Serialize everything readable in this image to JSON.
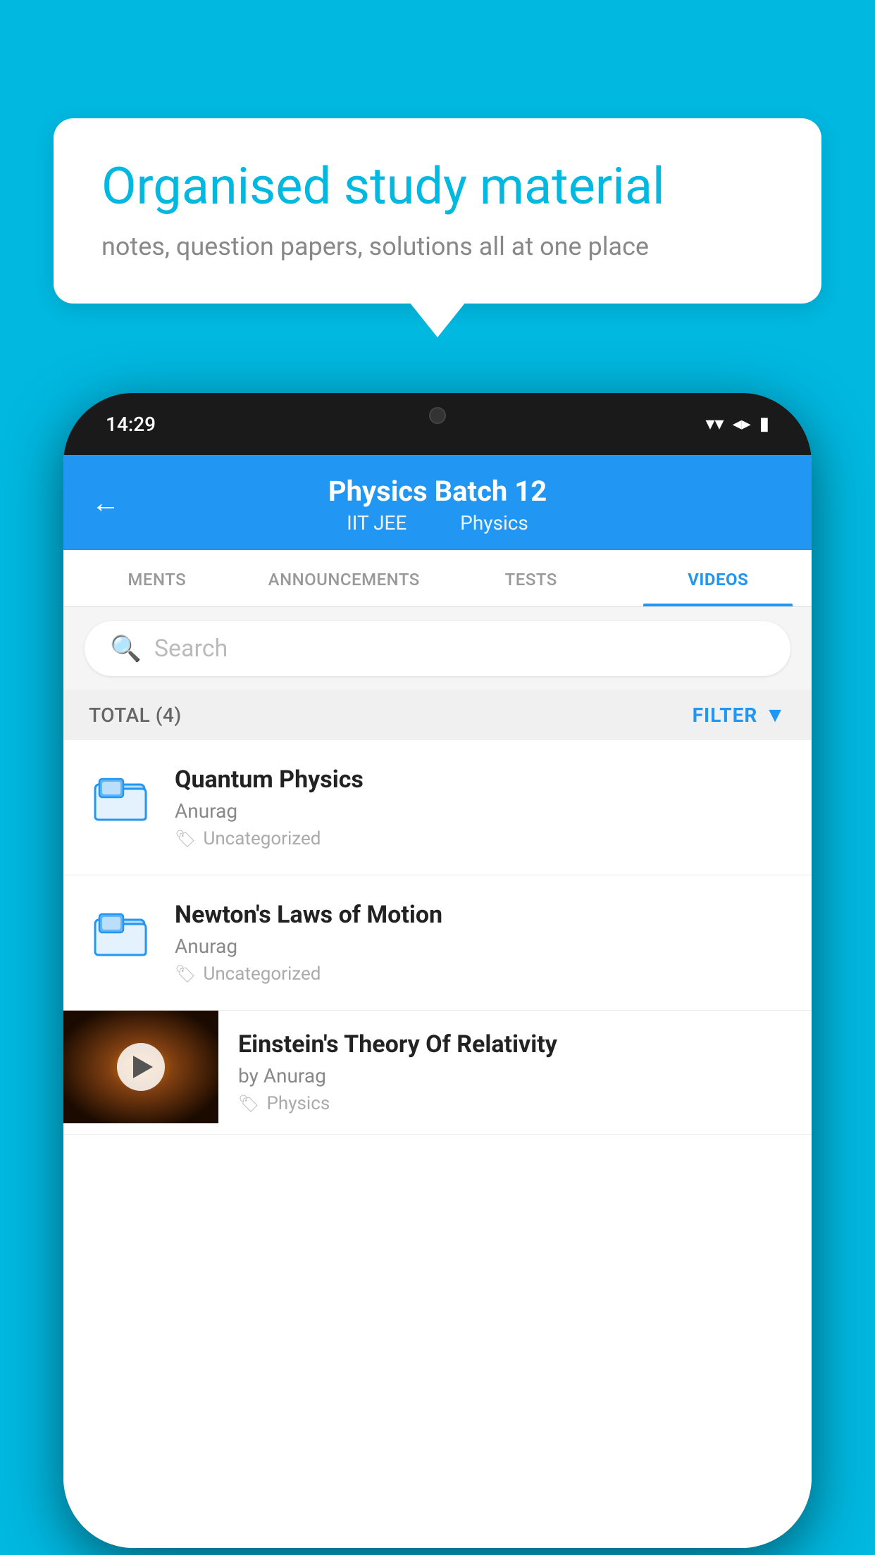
{
  "background_color": "#00b8e0",
  "speech_bubble": {
    "title": "Organised study material",
    "subtitle": "notes, question papers, solutions all at one place"
  },
  "phone": {
    "status_bar": {
      "time": "14:29",
      "wifi": "▼",
      "signal": "▲",
      "battery": "▮"
    },
    "header": {
      "back_label": "←",
      "title": "Physics Batch 12",
      "tag1": "IIT JEE",
      "tag2": "Physics"
    },
    "tabs": [
      {
        "label": "MENTS",
        "active": false
      },
      {
        "label": "ANNOUNCEMENTS",
        "active": false
      },
      {
        "label": "TESTS",
        "active": false
      },
      {
        "label": "VIDEOS",
        "active": true
      }
    ],
    "search": {
      "placeholder": "Search"
    },
    "filter_bar": {
      "total_label": "TOTAL (4)",
      "filter_label": "FILTER"
    },
    "videos": [
      {
        "id": "quantum",
        "title": "Quantum Physics",
        "author": "Anurag",
        "tag": "Uncategorized",
        "has_thumbnail": false
      },
      {
        "id": "newton",
        "title": "Newton's Laws of Motion",
        "author": "Anurag",
        "tag": "Uncategorized",
        "has_thumbnail": false
      },
      {
        "id": "einstein",
        "title": "Einstein's Theory Of Relativity",
        "author": "by Anurag",
        "tag": "Physics",
        "has_thumbnail": true
      }
    ]
  }
}
